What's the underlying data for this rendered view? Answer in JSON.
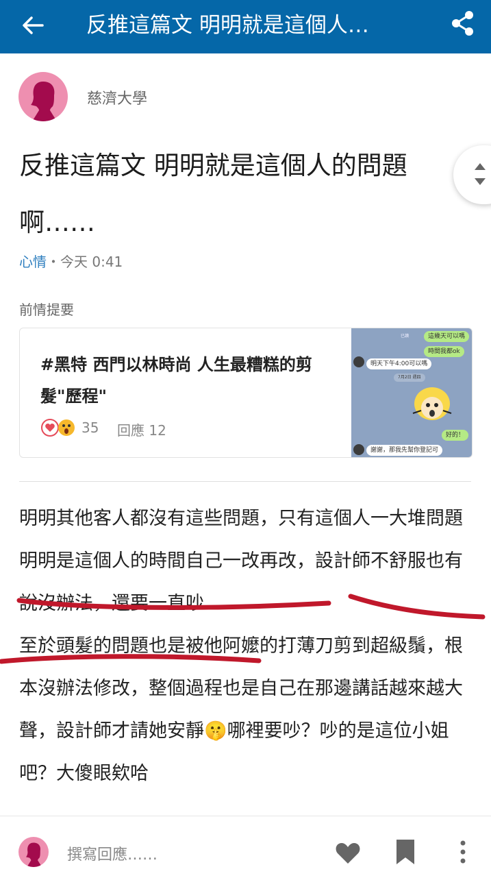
{
  "header": {
    "title": "反推這篇文 明明就是這個人…",
    "back_icon": "arrow-left-icon",
    "share_icon": "share-icon",
    "background": "#0567a8"
  },
  "post": {
    "author_school": "慈濟大學",
    "title": "反推這篇文 明明就是這個人的問題啊……",
    "category": "心情",
    "time": "・今天 0:41",
    "previous_label": "前情提要"
  },
  "referenced_post": {
    "title": "#黑特 西門以林時尚 人生最糟糕的剪髮\"歷程\"",
    "like_count": "35",
    "reply_text": "回應 12",
    "thumbnail_messages": [
      "這幾天可以嗎",
      "時間我都ok",
      "明天下午4:00可以嗎",
      "好的！",
      "謝謝，那我先幫你登記可"
    ]
  },
  "body": {
    "paragraphs": [
      "明明其他客人都沒有這些問題，只有這個人一大堆問題",
      "明明是這個人的時間自己一改再改，設計師不舒服也有說沒辦法，還要一直吵",
      "至於頭髮的問題也是被他阿嬤的打薄刀剪到超級鬚，根本沒辦法修改，整個過程也是自己在那邊講話越來越大聲，設計師才請她安靜🤫哪裡要吵？吵的是這位小姐吧？大傻眼欸哈"
    ]
  },
  "bottom_bar": {
    "reply_placeholder": "撰寫回應……",
    "icons": [
      "heart-icon",
      "bookmark-icon",
      "more-vertical-icon"
    ]
  },
  "colors": {
    "accent": "#0567a8",
    "avatar": "#ee8fb0",
    "category": "#2f7fbf",
    "annotation": "#c0182b"
  }
}
